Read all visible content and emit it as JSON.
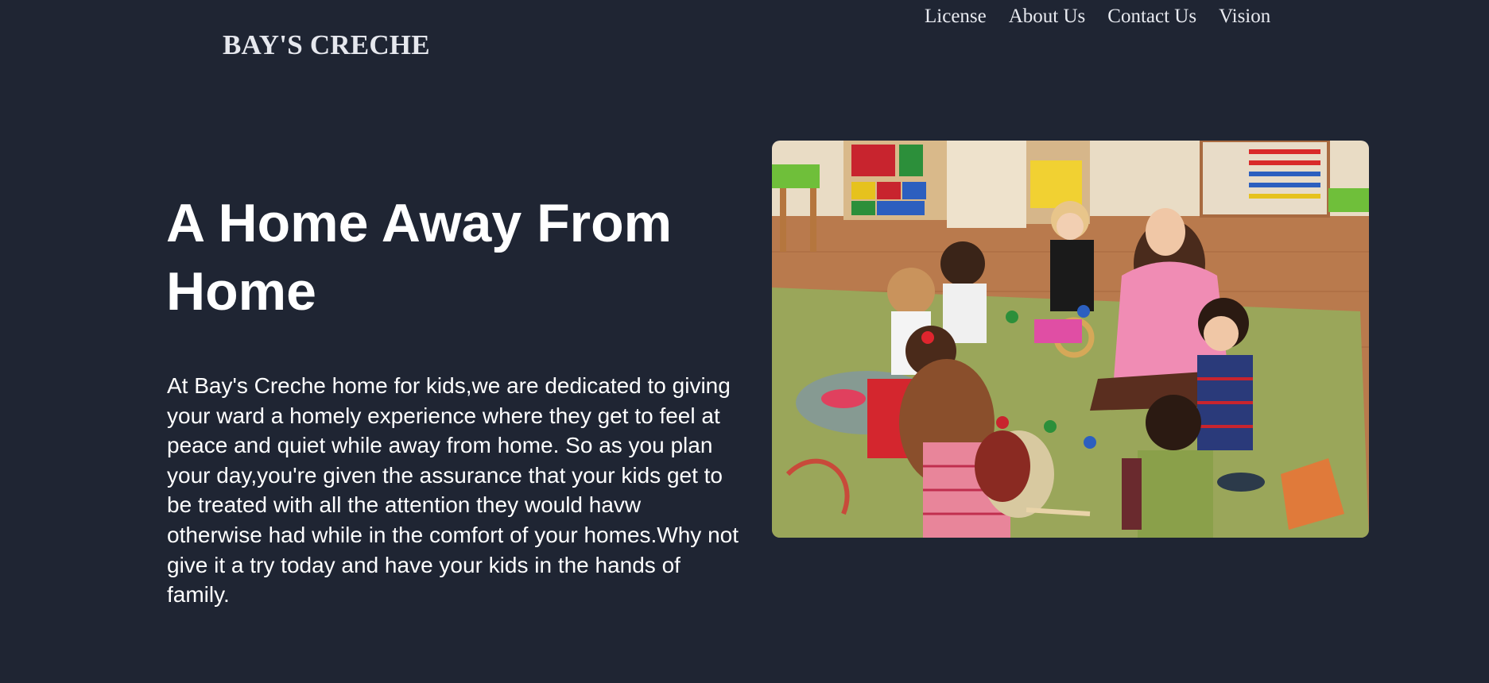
{
  "header": {
    "brand": "BAY'S CRECHE",
    "nav": [
      {
        "label": "License"
      },
      {
        "label": "About Us"
      },
      {
        "label": "Contact Us"
      },
      {
        "label": "Vision"
      }
    ]
  },
  "hero": {
    "title": "A Home Away From Home",
    "description": "At Bay's Creche home for kids,we are dedicated to giving your ward a homely experience where they get to feel at peace and quiet while away from home. So as you plan your day,you're given the assurance that your kids get to be treated with all the attention they would havw otherwise had while in the comfort of your homes.Why not give it a try today and have your kids in the hands of family."
  },
  "colors": {
    "background": "#1f2533",
    "text": "#ffffff"
  }
}
